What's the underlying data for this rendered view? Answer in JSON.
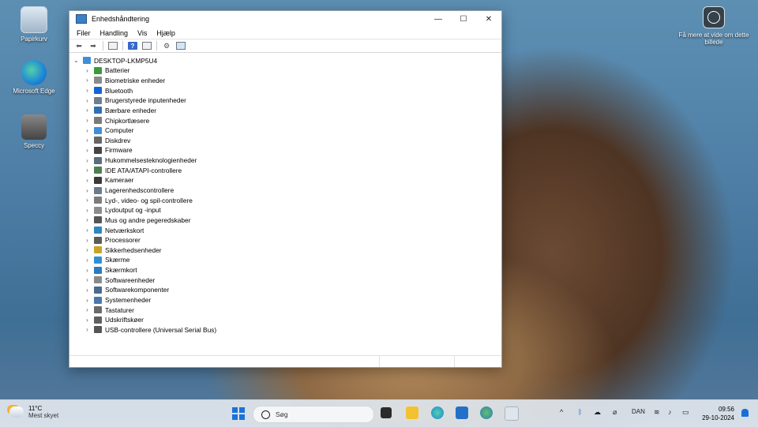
{
  "desktop": {
    "icons": [
      {
        "label": "Papirkurv"
      },
      {
        "label": "Microsoft Edge"
      },
      {
        "label": "Speccy"
      }
    ],
    "spotlight_label": "Få mere at vide om dette billede"
  },
  "window": {
    "title": "Enhedshåndtering",
    "controls": {
      "minimize": "—",
      "maximize": "☐",
      "close": "✕"
    },
    "menu": [
      "Filer",
      "Handling",
      "Vis",
      "Hjælp"
    ],
    "toolbar_icons": [
      "back-arrow-icon",
      "forward-arrow-icon",
      "properties-icon",
      "help-icon",
      "view-icon",
      "scan-hardware-icon",
      "monitor-icon"
    ],
    "root": "DESKTOP-LKMP5U4",
    "categories": [
      {
        "label": "Batterier",
        "color": "#3c9a3c"
      },
      {
        "label": "Biometriske enheder",
        "color": "#8a8a8a"
      },
      {
        "label": "Bluetooth",
        "color": "#1464d2"
      },
      {
        "label": "Brugerstyrede inputenheder",
        "color": "#6f7f8f"
      },
      {
        "label": "Bærbare enheder",
        "color": "#2f6fb5"
      },
      {
        "label": "Chipkortlæsere",
        "color": "#7a7a7a"
      },
      {
        "label": "Computer",
        "color": "#3f8fd6"
      },
      {
        "label": "Diskdrev",
        "color": "#666666"
      },
      {
        "label": "Firmware",
        "color": "#444444"
      },
      {
        "label": "Hukommelsesteknologienheder",
        "color": "#5a6d80"
      },
      {
        "label": "IDE ATA/ATAPI-controllere",
        "color": "#4f7f4f"
      },
      {
        "label": "Kameraer",
        "color": "#3a3a3a"
      },
      {
        "label": "Lagerenhedscontrollere",
        "color": "#6b7b8c"
      },
      {
        "label": "Lyd-, video- og spil-controllere",
        "color": "#7c7c7c"
      },
      {
        "label": "Lydoutput og -input",
        "color": "#8c8c8c"
      },
      {
        "label": "Mus og andre pegeredskaber",
        "color": "#555555"
      },
      {
        "label": "Netværkskort",
        "color": "#2e86c1"
      },
      {
        "label": "Processorer",
        "color": "#5b5b5b"
      },
      {
        "label": "Sikkerhedsenheder",
        "color": "#c9a227"
      },
      {
        "label": "Skærme",
        "color": "#2f8fd8"
      },
      {
        "label": "Skærmkort",
        "color": "#2a7bbf"
      },
      {
        "label": "Softwareenheder",
        "color": "#8a8a8a"
      },
      {
        "label": "Softwarekomponenter",
        "color": "#4b6b8b"
      },
      {
        "label": "Systemenheder",
        "color": "#4a78a8"
      },
      {
        "label": "Tastaturer",
        "color": "#6a6a6a"
      },
      {
        "label": "Udskriftskøer",
        "color": "#5f5f5f"
      },
      {
        "label": "USB-controllere (Universal Serial Bus)",
        "color": "#555555"
      }
    ]
  },
  "taskbar": {
    "weather": {
      "temp": "11°C",
      "desc": "Mest skyet"
    },
    "search_placeholder": "Søg",
    "language": "DAN",
    "time": "09:56",
    "date": "29-10-2024"
  }
}
